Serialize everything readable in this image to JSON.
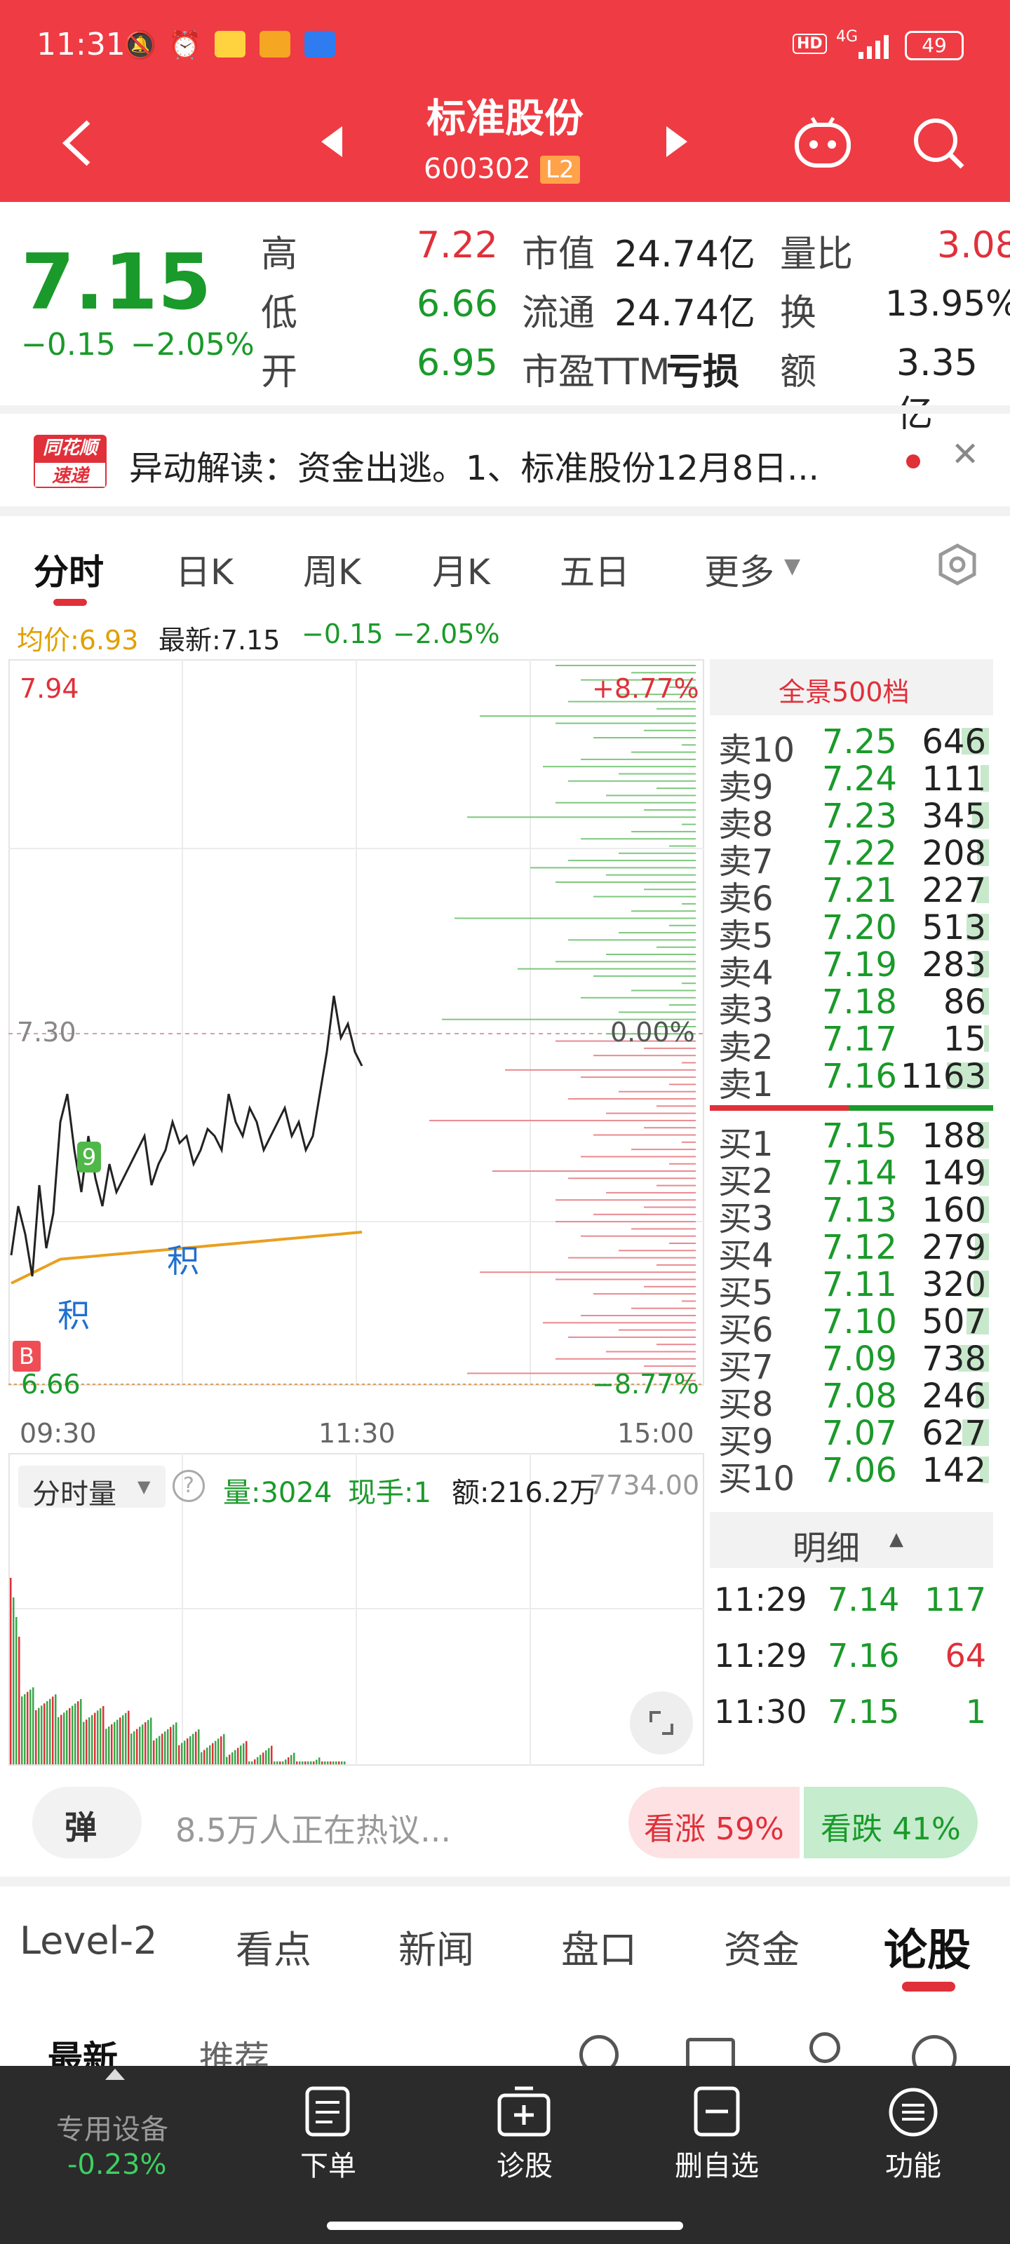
{
  "status": {
    "time": "11:31",
    "hd": "HD",
    "net": "4G",
    "battery": "49"
  },
  "header": {
    "title": "标准股份",
    "code": "600302",
    "badge": "L2"
  },
  "quote": {
    "price": "7.15",
    "change": "−0.15",
    "pct": "−2.05%",
    "high_label": "高",
    "high": "7.22",
    "low_label": "低",
    "low": "6.66",
    "open_label": "开",
    "open": "6.95",
    "mcap_label": "市值",
    "mcap": "24.74亿",
    "float_label": "流通",
    "float": "24.74亿",
    "pe_label": "市盈TTM",
    "pe": "亏损",
    "vr_label": "量比",
    "vr": "3.08",
    "turn_label": "换",
    "turn": "13.95%",
    "amt_label": "额",
    "amt": "3.35亿"
  },
  "news": {
    "logo_top": "同花顺",
    "logo_bottom": "速递",
    "text": "异动解读：资金出逃。1、标准股份12月8日..."
  },
  "tabs": [
    "分时",
    "日K",
    "周K",
    "月K",
    "五日",
    "更多"
  ],
  "chart_info": {
    "avg": "均价:6.93",
    "latest": "最新:7.15",
    "chg": "−0.15",
    "pct": "−2.05%"
  },
  "chart": {
    "top_price": "7.94",
    "mid_price": "7.30",
    "bot_price": "6.66",
    "top_pct": "+8.77%",
    "mid_pct": "0.00%",
    "bot_pct": "−8.77%",
    "t1": "09:30",
    "t2": "11:30",
    "t3": "15:00",
    "mark9": "9",
    "markji": "积",
    "markB": "B"
  },
  "volume": {
    "label": "分时量",
    "vol": "量:3024",
    "hand": "现手:1",
    "amt": "额:216.2万",
    "max": "7734.00"
  },
  "book_title": "全景500档",
  "asks": [
    [
      "卖10",
      "7.25",
      "646"
    ],
    [
      "卖9",
      "7.24",
      "111"
    ],
    [
      "卖8",
      "7.23",
      "345"
    ],
    [
      "卖7",
      "7.22",
      "208"
    ],
    [
      "卖6",
      "7.21",
      "227"
    ],
    [
      "卖5",
      "7.20",
      "513"
    ],
    [
      "卖4",
      "7.19",
      "283"
    ],
    [
      "卖3",
      "7.18",
      "86"
    ],
    [
      "卖2",
      "7.17",
      "15"
    ],
    [
      "卖1",
      "7.16",
      "1163"
    ]
  ],
  "bids": [
    [
      "买1",
      "7.15",
      "188"
    ],
    [
      "买2",
      "7.14",
      "149"
    ],
    [
      "买3",
      "7.13",
      "160"
    ],
    [
      "买4",
      "7.12",
      "279"
    ],
    [
      "买5",
      "7.11",
      "320"
    ],
    [
      "买6",
      "7.10",
      "507"
    ],
    [
      "买7",
      "7.09",
      "738"
    ],
    [
      "买8",
      "7.08",
      "246"
    ],
    [
      "买9",
      "7.07",
      "627"
    ],
    [
      "买10",
      "7.06",
      "142"
    ]
  ],
  "detail_title": "明细",
  "ticks": [
    [
      "11:29",
      "7.14",
      "117"
    ],
    [
      "11:29",
      "7.16",
      "64"
    ],
    [
      "11:30",
      "7.15",
      "1"
    ]
  ],
  "discuss": {
    "dan": "弹",
    "text": "8.5万人正在热议...",
    "up": "看涨 59%",
    "down": "看跌 41%"
  },
  "bottom_tabs": [
    "Level-2",
    "看点",
    "新闻",
    "盘口",
    "资金",
    "论股"
  ],
  "sub_tabs": [
    "最新",
    "推荐"
  ],
  "nav": {
    "dev": "专用设备",
    "dev_pct": "-0.23%",
    "items": [
      "下单",
      "诊股",
      "删自选",
      "功能"
    ]
  }
}
